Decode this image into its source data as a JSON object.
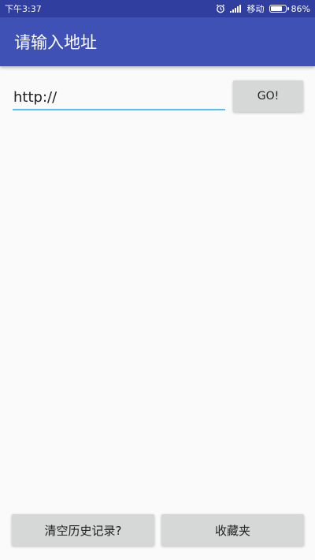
{
  "status_bar": {
    "time": "下午3:37",
    "carrier": "移动",
    "battery_percent": "86%",
    "battery_level": 0.86,
    "icons": [
      "alarm-icon",
      "signal-icon",
      "battery-icon"
    ]
  },
  "app_bar": {
    "title": "请输入地址",
    "background_color": "#3f51b5"
  },
  "url_field": {
    "value": "http://",
    "underline_color": "#4fc3f7"
  },
  "go_button": {
    "label": "GO!"
  },
  "bottom_buttons": {
    "clear_history_label": "清空历史记录?",
    "favorites_label": "收藏夹"
  }
}
